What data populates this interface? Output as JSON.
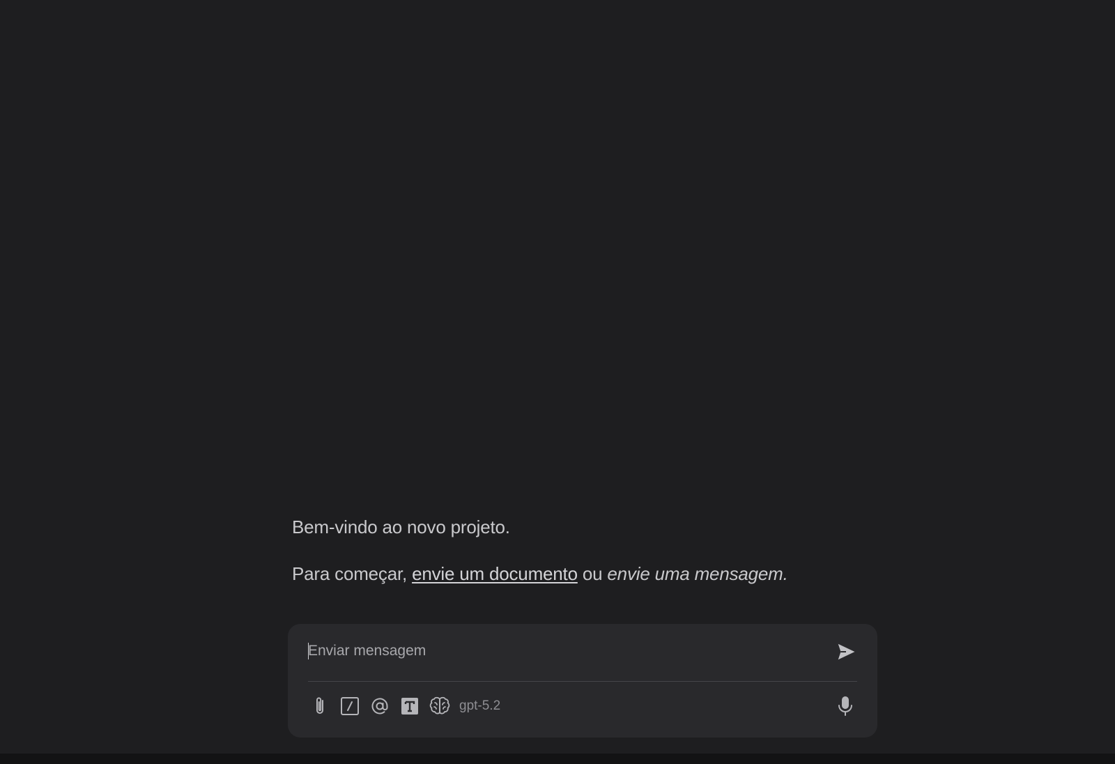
{
  "welcome": {
    "line1": "Bem-vindo ao novo projeto.",
    "line2_prefix": "Para começar,",
    "upload_link": "envie um documento",
    "line2_middle": "ou",
    "line2_italic": "envie uma mensagem."
  },
  "composer": {
    "placeholder": "Enviar mensagem",
    "model": "gpt-5.2",
    "icons": {
      "send": "send-icon",
      "attach": "paperclip-icon",
      "commands": "slash-command-icon",
      "mention": "at-mention-icon",
      "text_format": "text-format-icon",
      "reasoning": "brain-icon",
      "voice": "microphone-icon"
    }
  },
  "colors": {
    "background": "#1e1e20",
    "composer_background": "#29292c",
    "text": "#c9c9cc",
    "icon": "#b5b5b9",
    "muted": "#8e8e93"
  }
}
